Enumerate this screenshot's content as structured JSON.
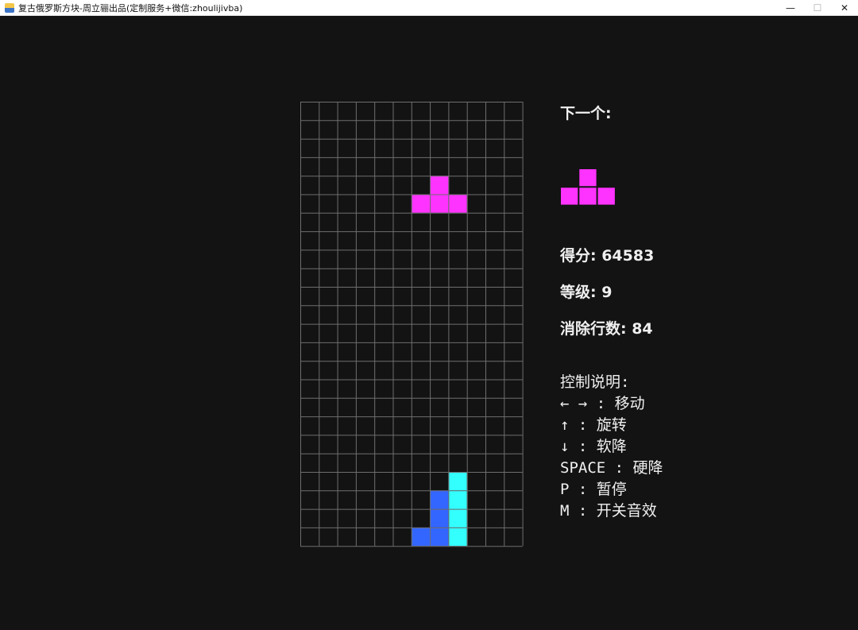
{
  "window": {
    "title": "复古俄罗斯方块-周立骊出品(定制服务+微信:zhoulijivba)",
    "minimize_glyph": "—",
    "maximize_glyph": "☐",
    "close_glyph": "✕"
  },
  "board": {
    "cols": 12,
    "rows": 24,
    "grid_color": "#6e6e6e",
    "background": "#131313",
    "cells": [
      {
        "col": 7,
        "row": 4,
        "color": "#ff33ff"
      },
      {
        "col": 6,
        "row": 5,
        "color": "#ff33ff"
      },
      {
        "col": 7,
        "row": 5,
        "color": "#ff33ff"
      },
      {
        "col": 8,
        "row": 5,
        "color": "#ff33ff"
      },
      {
        "col": 8,
        "row": 20,
        "color": "#33ffff"
      },
      {
        "col": 7,
        "row": 21,
        "color": "#3366ff"
      },
      {
        "col": 8,
        "row": 21,
        "color": "#33ffff"
      },
      {
        "col": 7,
        "row": 22,
        "color": "#3366ff"
      },
      {
        "col": 8,
        "row": 22,
        "color": "#33ffff"
      },
      {
        "col": 6,
        "row": 23,
        "color": "#3366ff"
      },
      {
        "col": 7,
        "row": 23,
        "color": "#3366ff"
      },
      {
        "col": 8,
        "row": 23,
        "color": "#33ffff"
      }
    ]
  },
  "next_piece": {
    "label": "下一个:",
    "color": "#ff33ff",
    "cells": [
      {
        "col": 1,
        "row": 0
      },
      {
        "col": 0,
        "row": 1
      },
      {
        "col": 1,
        "row": 1
      },
      {
        "col": 2,
        "row": 1
      }
    ]
  },
  "stats": {
    "score": "得分: 64583",
    "level": "等级: 9",
    "lines": "消除行数: 84"
  },
  "controls": {
    "title": "控制说明:",
    "lines": [
      "← → : 移动",
      "↑ : 旋转",
      "↓ : 软降",
      "SPACE : 硬降",
      "P : 暂停",
      "M : 开关音效"
    ]
  },
  "colors": {
    "background": "#131313",
    "text": "#f0f0f0",
    "magenta": "#ff33ff",
    "cyan": "#33ffff",
    "blue": "#3366ff"
  }
}
